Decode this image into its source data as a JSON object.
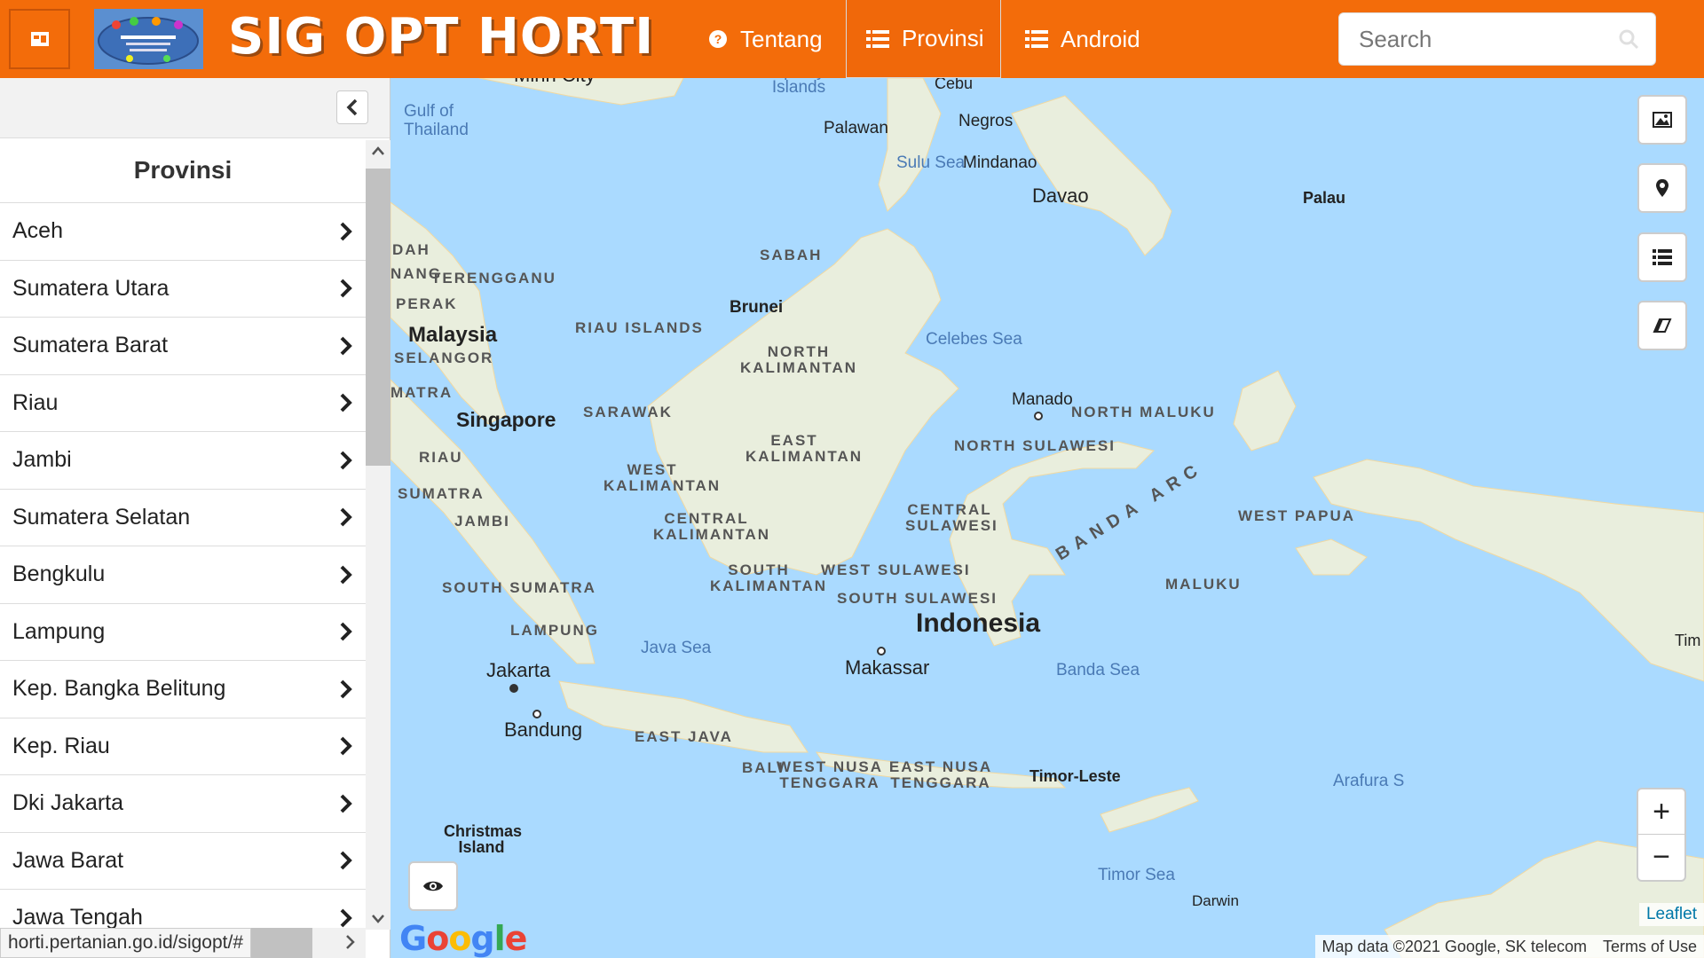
{
  "header": {
    "brand": "SIG OPT HORTI",
    "nav": [
      {
        "label": "Tentang",
        "icon": "question-circle-icon"
      },
      {
        "label": "Provinsi",
        "icon": "list-icon"
      },
      {
        "label": "Android",
        "icon": "list-icon"
      }
    ],
    "search_placeholder": "Search"
  },
  "sidebar": {
    "title": "Provinsi",
    "provinces": [
      "Aceh",
      "Sumatera Utara",
      "Sumatera Barat",
      "Riau",
      "Jambi",
      "Sumatera Selatan",
      "Bengkulu",
      "Lampung",
      "Kep. Bangka Belitung",
      "Kep. Riau",
      "Dki Jakarta",
      "Jawa Barat",
      "Jawa Tengah"
    ],
    "status_url": "horti.pertanian.go.id/sigopt/#"
  },
  "map": {
    "labels": {
      "minh_city": "Minh City",
      "spratly": "Spratly Islands",
      "cebu": "Cebu",
      "gulf_thailand": "Gulf of Thailand",
      "palawan": "Palawan",
      "negros": "Negros",
      "sulu_sea": "Sulu Sea",
      "mindanao": "Mindanao",
      "davao": "Davao",
      "palau": "Palau",
      "kedah": "DAH",
      "penang": "NANG",
      "terengganu": "TERENGGANU",
      "sabah": "SABAH",
      "perak": "PERAK",
      "brunei": "Brunei",
      "riau_islands": "RIAU ISLANDS",
      "malaysia": "Malaysia",
      "selangor": "SELANGOR",
      "north_kalimantan": "NORTH KALIMANTAN",
      "celebes_sea": "Celebes Sea",
      "sumatra_top": "MATRA",
      "singapore": "Singapore",
      "sarawak": "SARAWAK",
      "manado": "Manado",
      "north_maluku": "NORTH MALUKU",
      "east_kalimantan": "EAST KALIMANTAN",
      "north_sulawesi": "NORTH SULAWESI",
      "riau": "RIAU",
      "west_kalimantan": "WEST KALIMANTAN",
      "sumatra": "SUMATRA",
      "central_sulawesi": "CENTRAL SULAWESI",
      "west_papua": "WEST PAPUA",
      "jambi": "JAMBI",
      "central_kalimantan": "CENTRAL KALIMANTAN",
      "banda_arc": "BANDA ARC",
      "west_sulawesi": "WEST SULAWESI",
      "south_sumatra": "SOUTH SUMATRA",
      "south_kalimantan": "SOUTH KALIMANTAN",
      "maluku": "MALUKU",
      "south_sulawesi": "SOUTH SULAWESI",
      "indonesia": "Indonesia",
      "lampung": "LAMPUNG",
      "java_sea": "Java Sea",
      "timor_edge": "Tim",
      "jakarta": "Jakarta",
      "makassar": "Makassar",
      "banda_sea": "Banda Sea",
      "bandung": "Bandung",
      "east_java": "EAST JAVA",
      "bali": "BALI",
      "west_nusa_tenggara": "WEST NUSA TENGGARA",
      "east_nusa_tenggara": "EAST NUSA TENGGARA",
      "timor_leste": "Timor-Leste",
      "arafura": "Arafura S",
      "christmas_island": "Christmas Island",
      "timor_sea": "Timor Sea",
      "darwin": "Darwin"
    },
    "attribution": "Map data ©2021 Google, SK telecom",
    "terms": "Terms of Use",
    "leaflet": "Leaflet",
    "google": "Google"
  },
  "colors": {
    "brand_orange": "#f36c0a",
    "water": "#aadaff",
    "land": "#e8eedc"
  }
}
